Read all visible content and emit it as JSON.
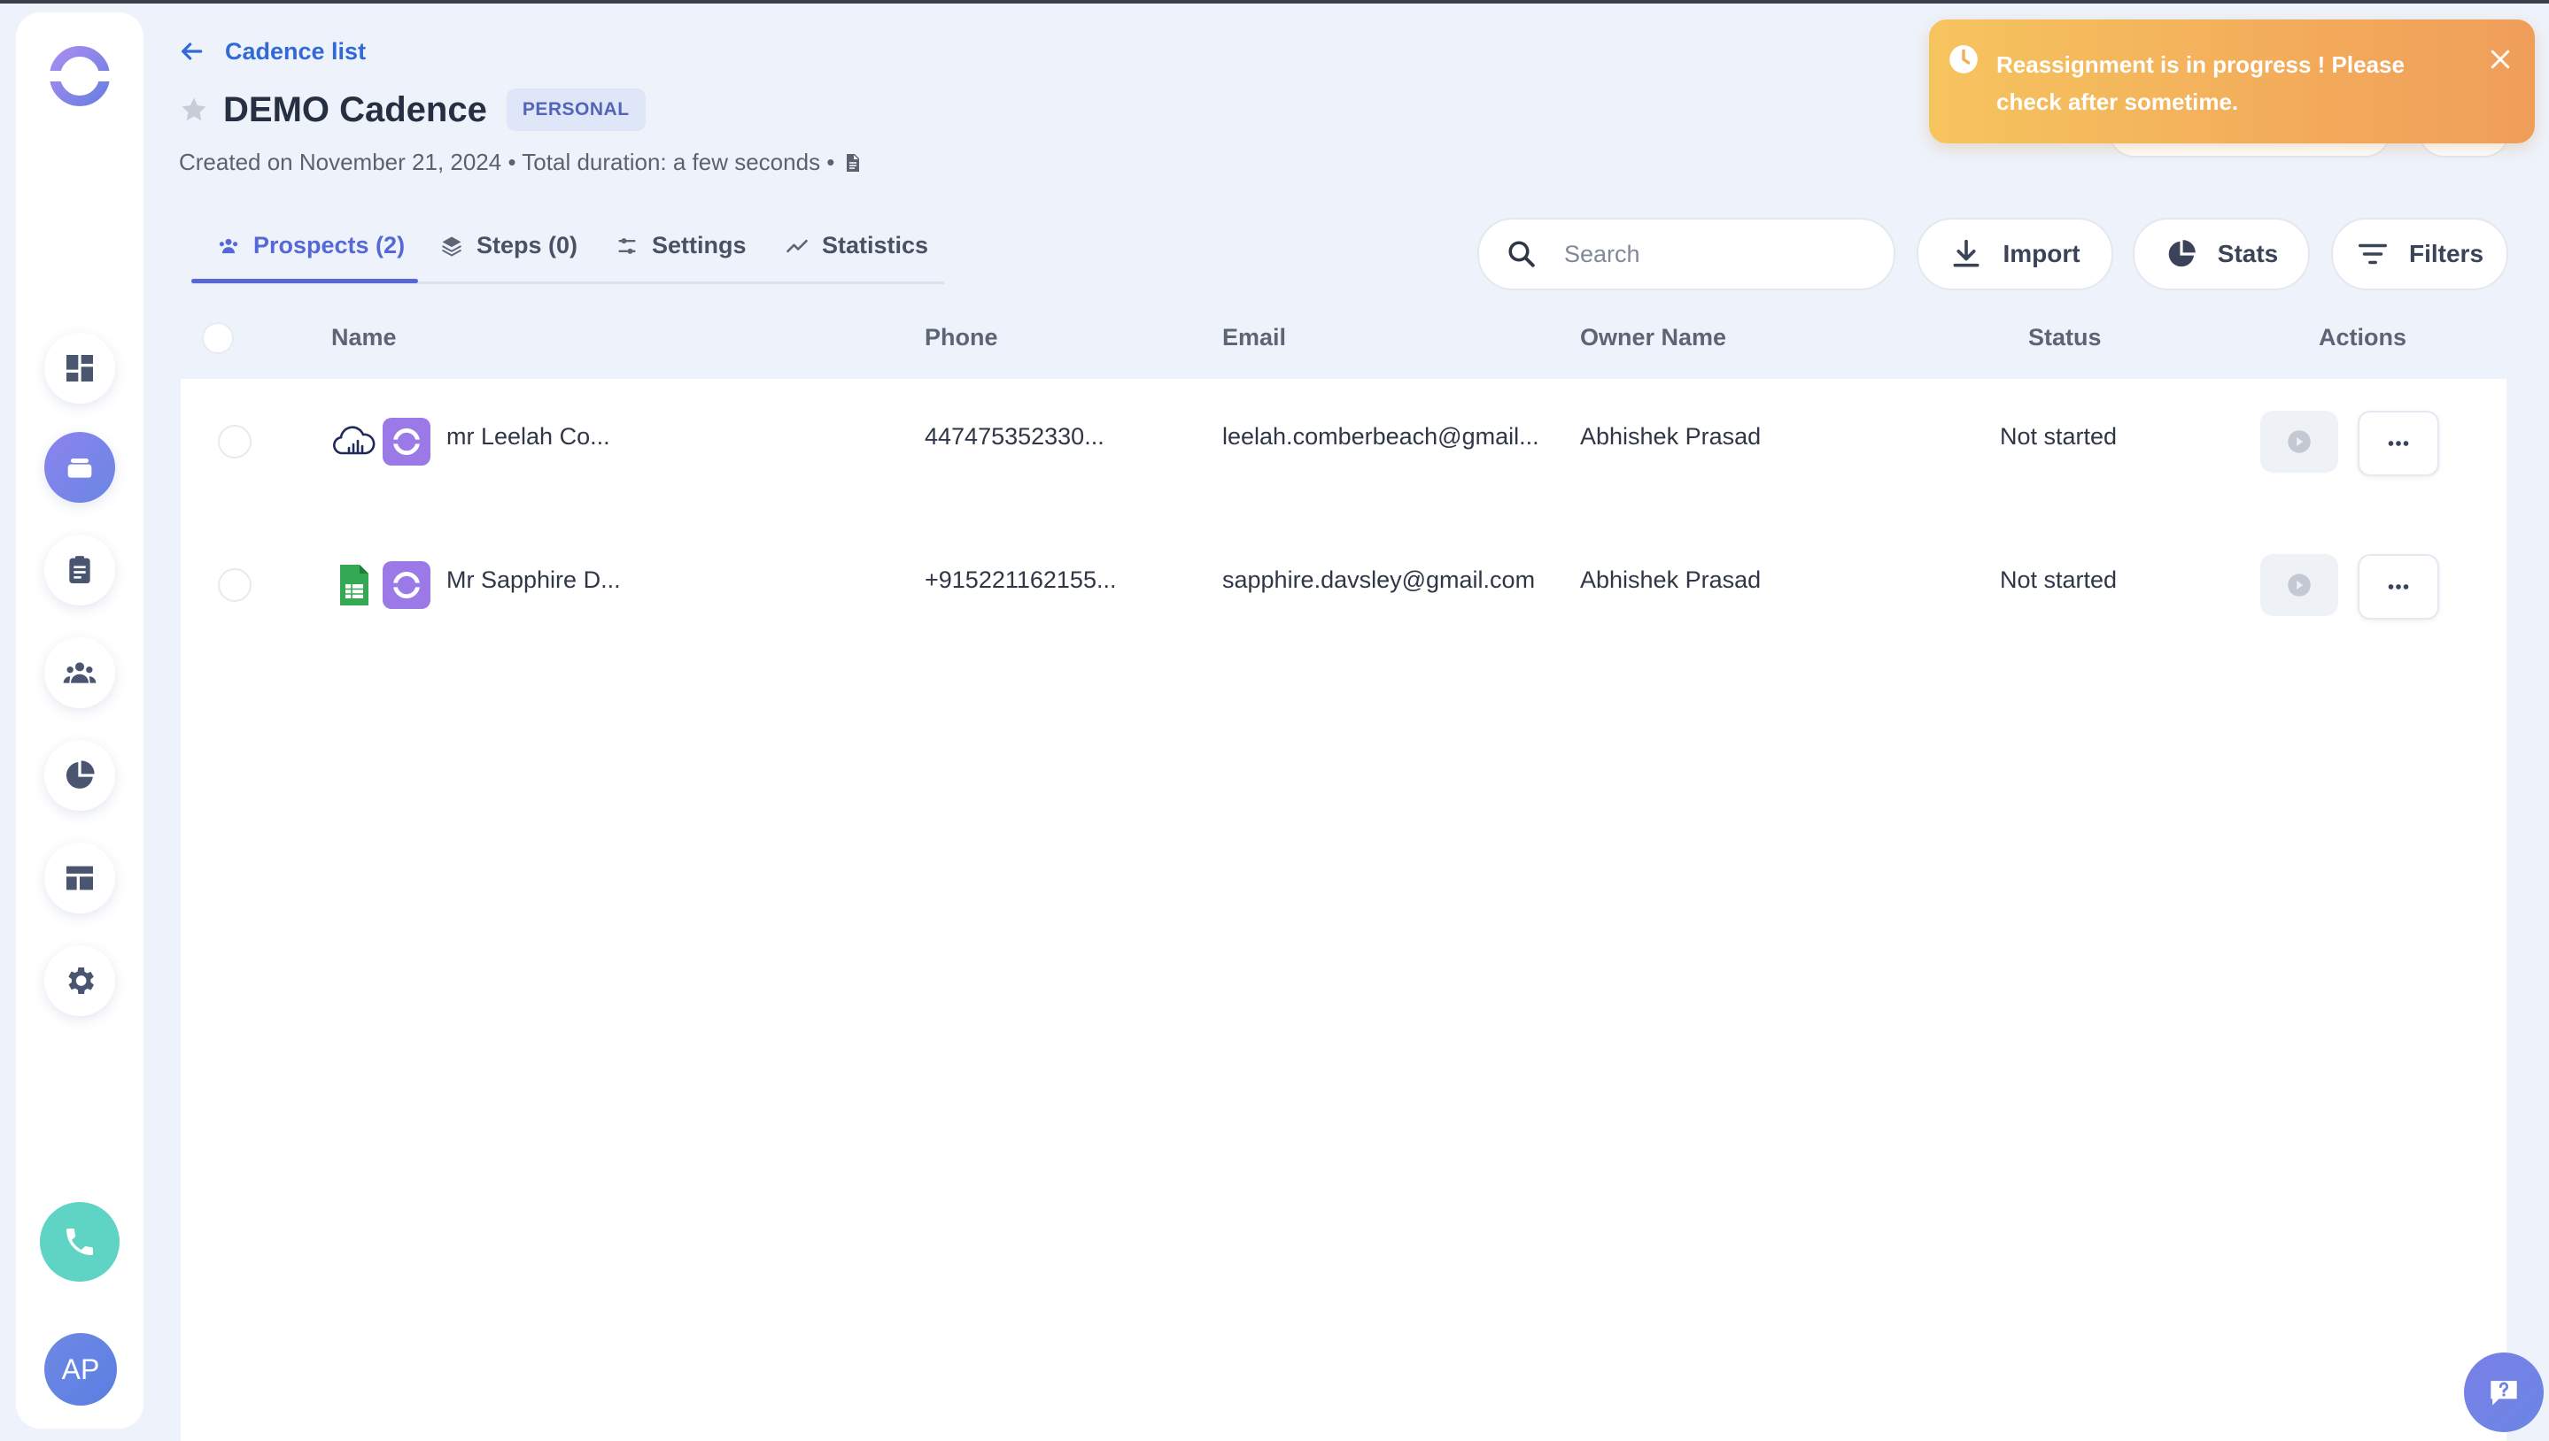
{
  "header": {
    "back_label": "Cadence list",
    "title": "DEMO Cadence",
    "badge": "PERSONAL",
    "meta": "Created on November 21, 2024 • Total duration: a few seconds •"
  },
  "toast": {
    "message": "Reassignment is in progress ! Please check after sometime."
  },
  "tabs": [
    {
      "label": "Prospects (2)",
      "icon": "people-icon"
    },
    {
      "label": "Steps (0)",
      "icon": "layers-icon"
    },
    {
      "label": "Settings",
      "icon": "sliders-icon"
    },
    {
      "label": "Statistics",
      "icon": "trend-icon"
    }
  ],
  "toolbar": {
    "search_placeholder": "Search",
    "import_label": "Import",
    "stats_label": "Stats",
    "filters_label": "Filters"
  },
  "table": {
    "columns": [
      "Name",
      "Phone",
      "Email",
      "Owner Name",
      "Status",
      "Actions"
    ],
    "rows": [
      {
        "source_icon": "cloud-signal-icon",
        "name": "mr Leelah Co...",
        "phone": "447475352330...",
        "email": "leelah.comberbeach@gmail...",
        "owner": "Abhishek Prasad",
        "status": "Not started"
      },
      {
        "source_icon": "spreadsheet-icon",
        "name": "Mr Sapphire D...",
        "phone": "+915221162155...",
        "email": "sapphire.davsley@gmail.com",
        "owner": "Abhishek Prasad",
        "status": "Not started"
      }
    ]
  },
  "sidebar": {
    "items": [
      "dashboard-icon",
      "cadence-icon",
      "tasks-icon",
      "people-icon",
      "reports-icon",
      "templates-icon",
      "settings-icon"
    ],
    "active_index": 1,
    "avatar_initials": "AP"
  },
  "colors": {
    "accent": "#5667d6",
    "link": "#3169d6",
    "toast": "#f2a85a",
    "call": "#5fd4c4"
  }
}
